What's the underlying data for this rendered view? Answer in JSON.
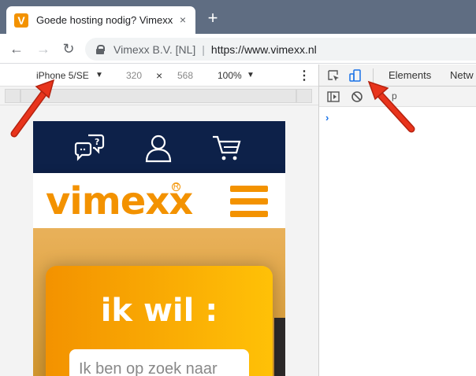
{
  "tab": {
    "favicon_letter": "V",
    "title": "Goede hosting nodig? Vimexx - l",
    "close_glyph": "×"
  },
  "new_tab_glyph": "+",
  "toolbar": {
    "back_glyph": "←",
    "forward_glyph": "→",
    "reload_glyph": "↻",
    "site_name": "Vimexx B.V. [NL]",
    "separator": "|",
    "url": "https://www.vimexx.nl"
  },
  "device_toolbar": {
    "device": "iPhone 5/SE",
    "device_caret": "▼",
    "width": "320",
    "times": "×",
    "height": "568",
    "zoom": "100%",
    "zoom_caret": "▼",
    "more_glyph": "⋮"
  },
  "devtools": {
    "tabs": [
      "Elements",
      "Netw"
    ],
    "filter_text": "p",
    "prompt": "›"
  },
  "page": {
    "logo_text": "vimexx",
    "registered": "R",
    "headline": "ik wil :",
    "search_placeholder": "Ik ben op zoek naar"
  },
  "colors": {
    "brand_orange": "#f39200",
    "navy": "#0d2149",
    "arrow_red": "#e8341c",
    "tab_strip": "#5f6d82"
  }
}
